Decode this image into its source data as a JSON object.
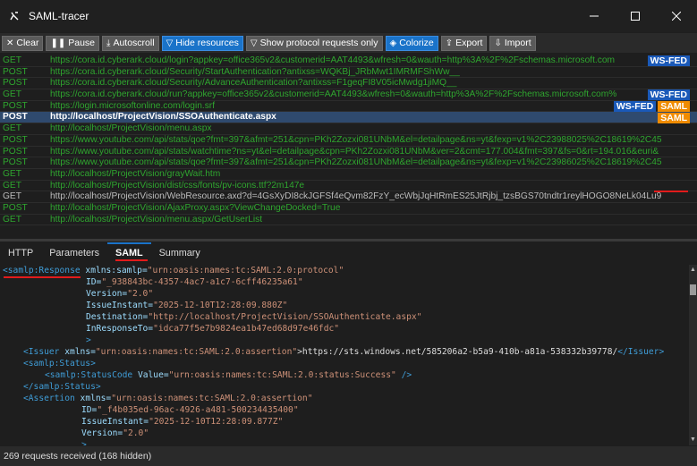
{
  "window": {
    "title": "SAML-tracer"
  },
  "toolbar": {
    "buttons": [
      {
        "icon": "✕",
        "label": "Clear",
        "active": false
      },
      {
        "icon": "❚❚",
        "label": "Pause",
        "active": false
      },
      {
        "icon": "⤓",
        "label": "Autoscroll",
        "active": false
      },
      {
        "icon": "▽",
        "label": "Hide resources",
        "active": true
      },
      {
        "icon": "▽",
        "label": "Show protocol requests only",
        "active": false
      },
      {
        "icon": "◈",
        "label": "Colorize",
        "active": true
      },
      {
        "icon": "⇪",
        "label": "Export",
        "active": false
      },
      {
        "icon": "⇩",
        "label": "Import",
        "active": false
      }
    ]
  },
  "requests": [
    {
      "method": "GET",
      "url": "https://cora.id.cyberark.cloud/login?appkey=office365v2&customerid=AAT4493&wfresh=0&wauth=http%3A%2F%2Fschemas.microsoft.com",
      "style": "green",
      "badges": [
        "WS-FED"
      ]
    },
    {
      "method": "POST",
      "url": "https://cora.id.cyberark.cloud/Security/StartAuthentication?antixss=WQKBj_JRbMwt1IMRMFShWw__",
      "style": "green",
      "badges": []
    },
    {
      "method": "POST",
      "url": "https://cora.id.cyberark.cloud/Security/AdvanceAuthentication?antixss=F1geqFI8V05icMwdg1jiMQ__",
      "style": "green",
      "badges": []
    },
    {
      "method": "GET",
      "url": "https://cora.id.cyberark.cloud/run?appkey=office365v2&customerid=AAT4493&wfresh=0&wauth=http%3A%2F%2Fschemas.microsoft.com%",
      "style": "green",
      "badges": [
        "WS-FED"
      ]
    },
    {
      "method": "POST",
      "url": "https://login.microsoftonline.com/login.srf",
      "style": "green",
      "badges": [
        "WS-FED",
        "SAML"
      ]
    },
    {
      "method": "POST",
      "url": "http://localhost/ProjectVision/SSOAuthenticate.aspx",
      "style": "sel",
      "badges": [
        "SAML"
      ]
    },
    {
      "method": "GET",
      "url": "http://localhost/ProjectVision/menu.aspx",
      "style": "green",
      "badges": []
    },
    {
      "method": "POST",
      "url": "https://www.youtube.com/api/stats/qoe?fmt=397&afmt=251&cpn=PKh2Zozxi081UNbM&el=detailpage&ns=yt&fexp=v1%2C23988025%2C18619%2C45",
      "style": "green",
      "badges": []
    },
    {
      "method": "POST",
      "url": "https://www.youtube.com/api/stats/watchtime?ns=yt&el=detailpage&cpn=PKh2Zozxi081UNbM&ver=2&cmt=177.004&fmt=397&fs=0&rt=194.016&euri&",
      "style": "green",
      "badges": []
    },
    {
      "method": "POST",
      "url": "https://www.youtube.com/api/stats/qoe?fmt=397&afmt=251&cpn=PKh2Zozxi081UNbM&el=detailpage&ns=yt&fexp=v1%2C23986025%2C18619%2C45",
      "style": "green",
      "badges": []
    },
    {
      "method": "GET",
      "url": "http://localhost/ProjectVision/grayWait.htm",
      "style": "green",
      "badges": []
    },
    {
      "method": "GET",
      "url": "http://localhost/ProjectVision/dist/css/fonts/pv-icons.ttf?2m147e",
      "style": "green",
      "badges": []
    },
    {
      "method": "GET",
      "url": "http://localhost/ProjectVision/WebResource.axd?d=4GsXyDI8ckJGFSf4eQvm82FzY_ecWbjJqHtRmES25JtRjbj_tzsBGS70tndtr1reylHOGO8NeLk04Lu9",
      "style": "grey",
      "badges": []
    },
    {
      "method": "POST",
      "url": "http://localhost/ProjectVision/AjaxProxy.aspx?ViewChangeDocked=True",
      "style": "green",
      "badges": []
    },
    {
      "method": "GET",
      "url": "http://localhost/ProjectVision/menu.aspx/GetUserList",
      "style": "green",
      "badges": []
    }
  ],
  "tabs": [
    {
      "label": "HTTP",
      "active": false
    },
    {
      "label": "Parameters",
      "active": false
    },
    {
      "label": "SAML",
      "active": true
    },
    {
      "label": "Summary",
      "active": false
    }
  ],
  "xml": {
    "l1_tag": "<samlp:Response",
    "l1_attr": "xmlns:samlp=",
    "l1_val": "\"urn:oasis:names:tc:SAML:2.0:protocol\"",
    "l2_attr": "ID=",
    "l2_val": "\"_938843bc-4357-4ac7-a1c7-6cff46235a61\"",
    "l3_attr": "Version=",
    "l3_val": "\"2.0\"",
    "l4_attr": "IssueInstant=",
    "l4_val": "\"2025-12-10T12:28:09.880Z\"",
    "l5_attr": "Destination=",
    "l5_val": "\"http://localhost/ProjectVision/SSOAuthenticate.aspx\"",
    "l6_attr": "InResponseTo=",
    "l6_val": "\"idca77f5e7b9824ea1b47ed68d97e46fdc\"",
    "l6_close": ">",
    "l7_tag": "<Issuer",
    "l7_attr": "xmlns=",
    "l7_val": "\"urn:oasis:names:tc:SAML:2.0:assertion\"",
    "l7_text": ">https://sts.windows.net/585206a2-b5a9-410b-a81a-538332b39778/",
    "l7_end": "</Issuer>",
    "l8_tag": "<samlp:Status>",
    "l9_tag": "<samlp:StatusCode",
    "l9_attr": "Value=",
    "l9_val": "\"urn:oasis:names:tc:SAML:2.0:status:Success\"",
    "l9_close": " />",
    "l10_tag": "</samlp:Status>",
    "l11_tag": "<Assertion",
    "l11_attr": "xmlns=",
    "l11_val": "\"urn:oasis:names:tc:SAML:2.0:assertion\"",
    "l12_attr": "ID=",
    "l12_val": "\"_f4b035ed-96ac-4926-a481-500234435400\"",
    "l13_attr": "IssueInstant=",
    "l13_val": "\"2025-12-10T12:28:09.877Z\"",
    "l14_attr": "Version=",
    "l14_val": "\"2.0\"",
    "l15_close": ">"
  },
  "status": {
    "text": "269 requests received (168 hidden)"
  }
}
